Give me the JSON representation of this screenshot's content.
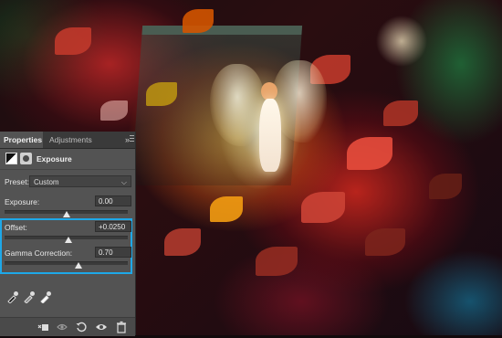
{
  "panel": {
    "tabs": [
      {
        "label": "Properties",
        "active": true
      },
      {
        "label": "Adjustments",
        "active": false
      }
    ],
    "collapse_glyph": "»",
    "adjustment": {
      "title": "Exposure",
      "icons": [
        "exposure-adjustment-icon",
        "layer-mask-icon"
      ]
    },
    "preset": {
      "label": "Preset:",
      "value": "Custom"
    },
    "exposure": {
      "label": "Exposure:",
      "value": "0.00",
      "slider_fraction": 0.5
    },
    "offset": {
      "label": "Offset:",
      "value": "+0.0250",
      "slider_fraction": 0.52
    },
    "gamma": {
      "label": "Gamma Correction:",
      "value": "0.70",
      "slider_fraction": 0.6
    },
    "eyedroppers": [
      "black-point-eyedropper-icon",
      "gray-point-eyedropper-icon",
      "white-point-eyedropper-icon"
    ],
    "bottom_icons": [
      "clip-to-layer-icon",
      "view-previous-state-icon",
      "reset-icon",
      "visibility-eye-icon",
      "trash-icon"
    ]
  },
  "colors": {
    "panel_bg": "#535353",
    "highlight": "#1ea8e8"
  }
}
